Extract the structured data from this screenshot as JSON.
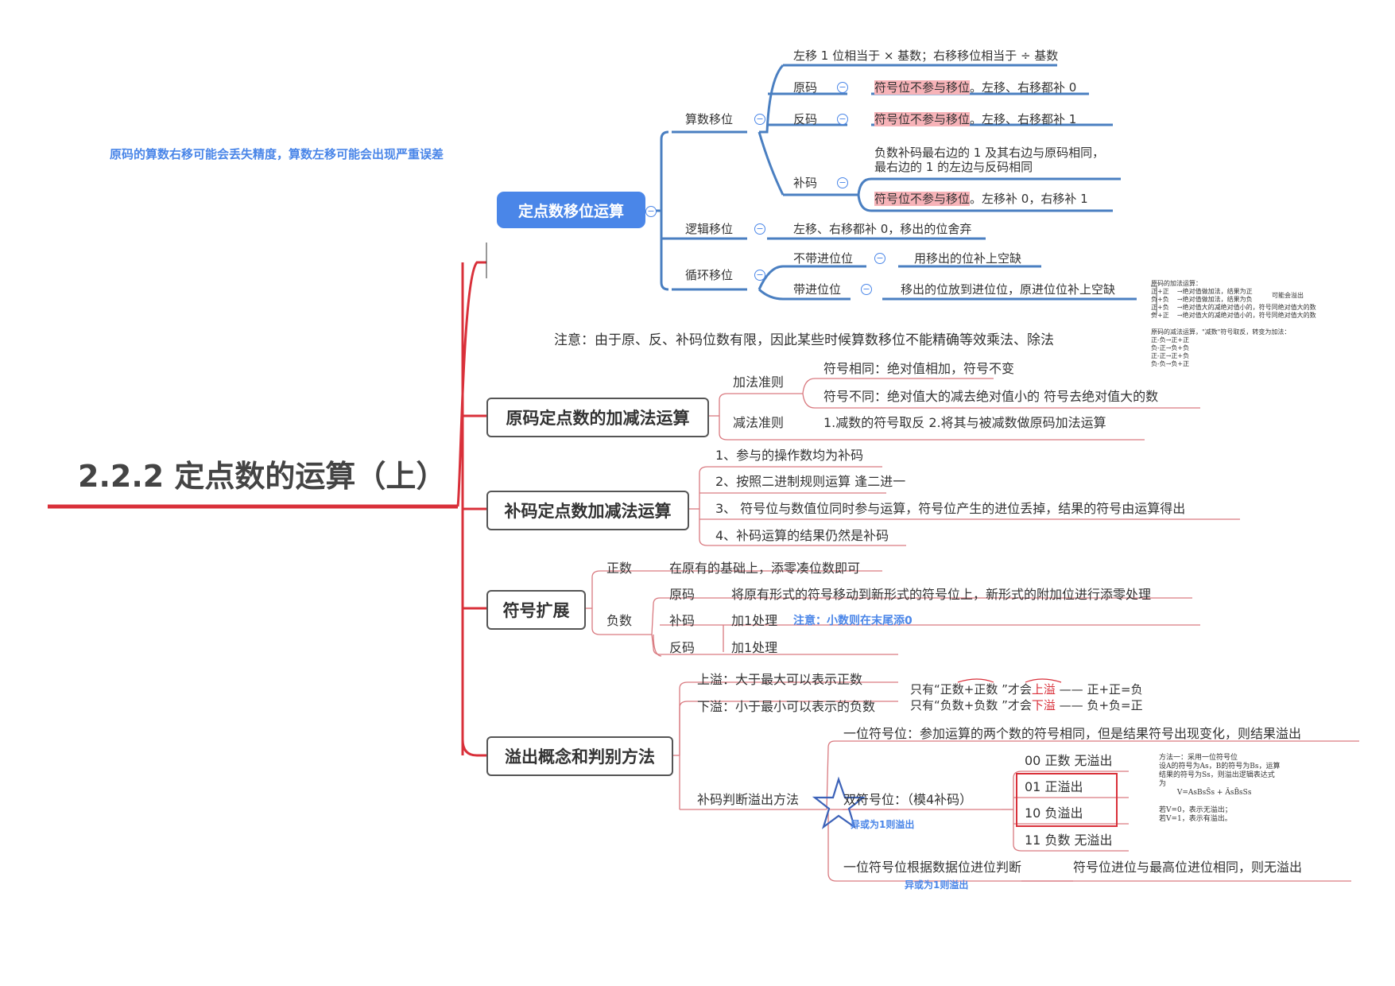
{
  "root_title": "2.2.2 定点数的运算（上）",
  "top_note": "原码的算数右移可能会丢失精度，算数左移可能会出现严重误差",
  "shift": {
    "title": "定点数移位运算",
    "arith": {
      "label": "算数移位",
      "rule": "左移 1 位相当于 × 基数；右移移位相当于 ÷ 基数",
      "orig_label": "原码",
      "orig_hl": "符号位不参与移位",
      "orig_rest": "。左移、右移都补 0",
      "ones_label": "反码",
      "ones_hl": "符号位不参与移位",
      "ones_rest": "。左移、右移都补 1",
      "twos_label": "补码",
      "twos_desc1": "负数补码最右边的 1 及其右边与原码相同，",
      "twos_desc2": "最右边的 1 的左边与反码相同",
      "twos_hl": "符号位不参与移位",
      "twos_rest": "。左移补 0，右移补 1"
    },
    "logic": {
      "label": "逻辑移位",
      "desc": "左移、右移都补 0，移出的位舍弃"
    },
    "cyclic": {
      "label": "循环移位",
      "no_carry_label": "不带进位位",
      "no_carry_desc": "用移出的位补上空缺",
      "carry_label": "带进位位",
      "carry_desc": "移出的位放到进位位，原进位位补上空缺"
    }
  },
  "shift_note": "注意：由于原、反、补码位数有限，因此某些时候算数移位不能精确等效乘法、除法",
  "side_notes": {
    "add": "原码的加法运算：\n正+正    →绝对值做加法，结果为正\n负+负    →绝对值做加法，结果为负\n正+负    →绝对值大的减绝对值小的，符号同绝对值大的数\n负+正    →绝对值大的减绝对值小的，符号同绝对值大的数",
    "add_overflow": "可能会溢出",
    "sub": "原码的减法运算，\"减数\"符号取反，转变为加法：\n正-负→正+正\n负-正→负+负\n正-正→正+负\n负-负→负+正"
  },
  "sign_mag_addsub": {
    "title": "原码定点数的加减法运算",
    "add_rule": "加法准则",
    "add_same": "符号相同：绝对值相加，符号不变",
    "add_diff": "符号不同：绝对值大的减去绝对值小的  符号去绝对值大的数",
    "sub_rule": "减法准则",
    "sub_desc": "1.减数的符号取反  2.将其与被减数做原码加法运算"
  },
  "twos_addsub": {
    "title": "补码定点数加减法运算",
    "items": [
      "1、参与的操作数均为补码",
      "2、按照二进制规则运算  逢二进一",
      "3、 符号位与数值位同时参与运算，符号位产生的进位丢掉，结果的符号由运算得出",
      "4、补码运算的结果仍然是补码"
    ]
  },
  "sign_ext": {
    "title": "符号扩展",
    "pos_label": "正数",
    "pos_desc": "在原有的基础上，添零凑位数即可",
    "neg_label": "负数",
    "orig_label": "原码",
    "orig_desc": "将原有形式的符号移动到新形式的符号位上，新形式的附加位进行添零处理",
    "twos_label": "补码",
    "twos_desc": "加1处理",
    "twos_note": "注意：小数则在末尾添0",
    "ones_label": "反码",
    "ones_desc": "加1处理"
  },
  "overflow": {
    "title": "溢出概念和判别方法",
    "up": "上溢：大于最大可以表示正数",
    "down": "下溢：小于最小可以表示的负数",
    "note1_a": "只有“正数+正数 ”才会",
    "note1_b": "上溢",
    "note1_c": " —— 正+正=负",
    "note2_a": "只有“负数+负数 ”才会",
    "note2_b": "下溢",
    "note2_c": " —— 负+负=正",
    "method_label": "补码判断溢出方法",
    "single": "一位符号位：参加运算的两个数的符号相同，但是结果符号出现变化，则结果溢出",
    "double": "双符号位：（模4补码）",
    "xor_note1": "异或为1则溢出",
    "codes": [
      "00  正数  无溢出",
      "01  正溢出",
      "10  负溢出",
      "11  负数  无溢出"
    ],
    "carry": "一位符号位根据数据位进位判断",
    "carry_desc": "符号位进位与最高位进位相同，则无溢出",
    "xor_note2": "异或为1则溢出",
    "method_note": "方法一：采用一位符号位\n设A的符号为As，B的符号为Bs，运算\n结果的符号为Ss，则溢出逻辑表达式\n为\n        V=AsBsS̄s + ĀsB̄sSs\n\n若V=0，表示无溢出；\n若V=1，表示有溢出。"
  },
  "colors": {
    "main_branch": "#d9303a",
    "node_blue": "#4a86e8",
    "underline": "#4a7fc1",
    "highlight": "#f7b3b8"
  }
}
